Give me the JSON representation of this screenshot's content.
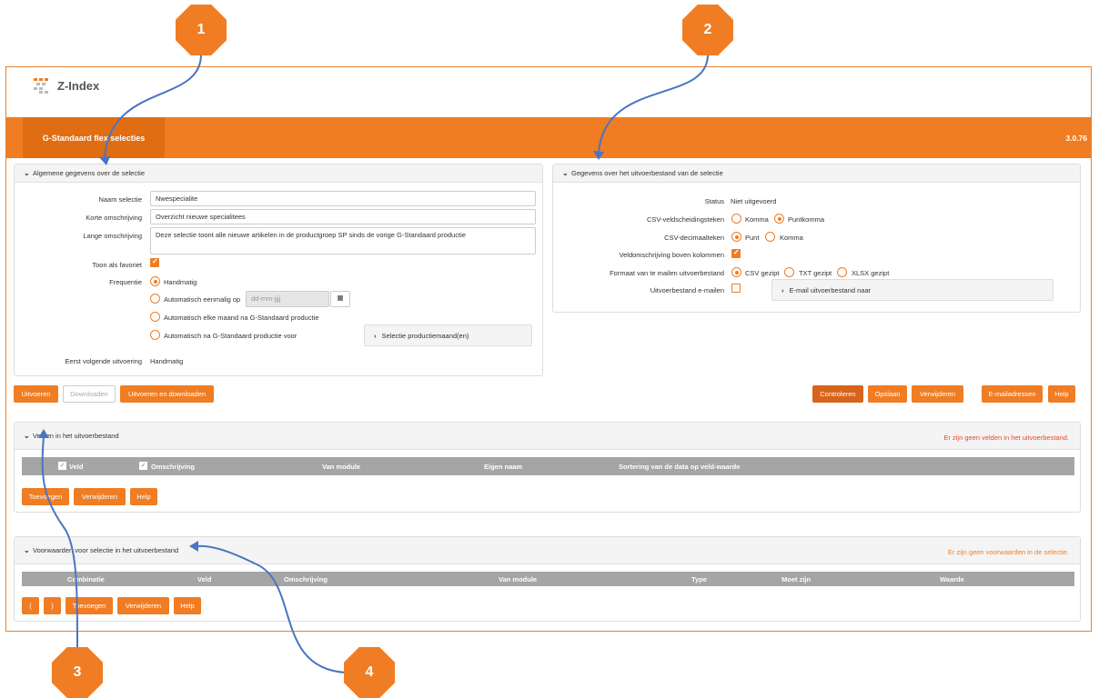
{
  "app": {
    "logo": "Z-Index",
    "tab": "G-Standaard flex selecties",
    "version": "3.0.76"
  },
  "badges": [
    "1",
    "2",
    "3",
    "4"
  ],
  "general": {
    "header": "Algemene gegevens over de selectie",
    "naam_label": "Naam selectie",
    "naam_value": "Nwespecialite",
    "kort_label": "Korte omschrijving",
    "kort_value": "Overzicht nieuwe specialitees",
    "lang_label": "Lange omschrijving",
    "lang_value": "Deze selectie toont alle nieuwe artikelen in de productgroep SP sinds de vorige G-Standaard productie",
    "favoriet_label": "Toon als favoriet",
    "frequentie_label": "Frequentie",
    "freq_options": [
      "Handmatig",
      "Automatisch eenmalig op",
      "Automatisch elke maand na G-Standaard productie",
      "Automatisch na G-Standaard productie voor"
    ],
    "date_placeholder": "dd-mm-jjjj",
    "selectie_productiemaand": "Selectie productiemaand(en)",
    "eerst_label": "Eerst volgende uitvoering",
    "eerst_value": "Handmatig"
  },
  "output": {
    "header": "Gegevens over het uitvoerbestand van de selectie",
    "status_label": "Status",
    "status_value": "Niet uitgevoerd",
    "csv_sep_label": "CSV-veldscheidingsteken",
    "csv_sep_options": [
      "Komma",
      "Puntkomma"
    ],
    "csv_dec_label": "CSV-decimaalteken",
    "csv_dec_options": [
      "Punt",
      "Komma"
    ],
    "veld_boven_label": "Veldomschrijving boven kolommen",
    "formaat_label": "Formaat van te mailen uitvoerbestand",
    "formaat_options": [
      "CSV gezipt",
      "TXT gezipt",
      "XLSX gezipt"
    ],
    "email_label": "Uitvoerbestand e-mailen",
    "email_box": "E-mail uitvoerbestand naar"
  },
  "actions": {
    "uitvoeren": "Uitvoeren",
    "downloaden": "Downloaden",
    "uitvoeren_download": "Uitvoeren en downloaden",
    "controleren": "Controleren",
    "opslaan": "Opslaan",
    "verwijderen": "Verwijderen",
    "emailadressen": "E-mailadressen",
    "help": "Help"
  },
  "velden": {
    "header": "Velden in het uitvoerbestand",
    "note": "Er zijn geen velden in het uitvoerbestand.",
    "columns": [
      "Veld",
      "Omschrijving",
      "Van module",
      "Eigen naam",
      "Sortering van de data op veld-waarde"
    ],
    "buttons": [
      "Toevoegen",
      "Verwijderen",
      "Help"
    ]
  },
  "voorwaarden": {
    "header": "Voorwaarden voor selectie in het uitvoerbestand",
    "note": "Er zijn geen voorwaarden in de selectie.",
    "columns": [
      "Combinatie",
      "Veld",
      "Omschrijving",
      "Van module",
      "Type",
      "Moet zijn",
      "Waarde"
    ],
    "buttons": [
      "(",
      ")",
      "Toevoegen",
      "Verwijderen",
      "Help"
    ]
  }
}
